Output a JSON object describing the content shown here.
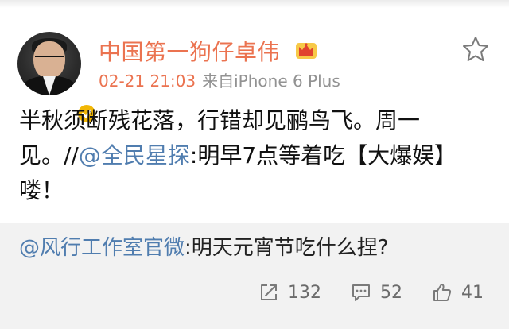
{
  "user": {
    "name": "中国第一狗仔卓伟",
    "badge_icon": "crown-icon",
    "verified_icon": "verified-check-icon"
  },
  "post": {
    "time": "02-21 21:03",
    "source": "来自iPhone 6 Plus",
    "text_part1": "半秋须断残花落，行错却见鹂鸟飞。周一见。//",
    "mention": "@全民星探",
    "text_part2": ":明早7点等着吃【大爆娱】喽！"
  },
  "retweet": {
    "mention": "@风行工作室官微",
    "text": ":明天元宵节吃什么捏?"
  },
  "actions": {
    "repost_count": "132",
    "comment_count": "52",
    "like_count": "41"
  },
  "colors": {
    "accent": "#eb7350",
    "link": "#507daf",
    "muted": "#929292",
    "retweet_bg": "#f2f2f2",
    "verified": "#f2b705"
  }
}
